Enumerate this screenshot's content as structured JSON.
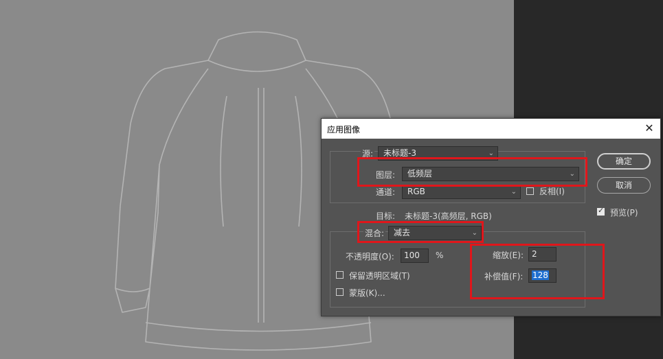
{
  "dialog": {
    "title": "应用图像",
    "close_icon": "close-icon",
    "source": {
      "label": "源:",
      "value": "未标题-3"
    },
    "layer": {
      "label": "图层:",
      "value": "低频层"
    },
    "channel": {
      "label": "通道:",
      "value": "RGB"
    },
    "invert": {
      "label": "反相(I)",
      "checked": false
    },
    "target": {
      "label": "目标:",
      "value": "未标题-3(高频层, RGB)"
    },
    "blending": {
      "label": "混合:",
      "value": "减去"
    },
    "opacity": {
      "label": "不透明度(O):",
      "value": "100",
      "unit": "%"
    },
    "preserve_transparency": {
      "label": "保留透明区域(T)",
      "checked": false
    },
    "mask": {
      "label": "蒙版(K)...",
      "checked": false
    },
    "scale": {
      "label": "缩放(E):",
      "value": "2"
    },
    "offset": {
      "label": "补偿值(F):",
      "value": "128"
    },
    "ok_label": "确定",
    "cancel_label": "取消",
    "preview": {
      "label": "预览(P)",
      "checked": true
    }
  },
  "colors": {
    "highlight": "#e0161b",
    "canvas": "#8a8a8a",
    "dialog_bg": "#535353"
  }
}
